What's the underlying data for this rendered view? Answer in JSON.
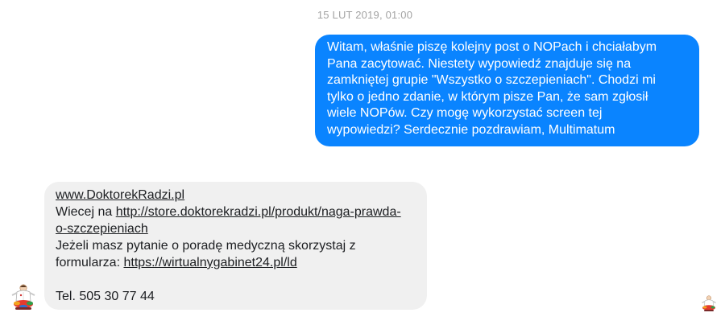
{
  "timestamp": "15 LUT 2019, 01:00",
  "outgoing_message": {
    "lines": [
      "Witam, właśnie piszę kolejny post o NOPach i chciałabym",
      "Pana zacytować. Niestety wypowiedź znajduje się na",
      "zamkniętej grupie \"Wszystko o szczepieniach\". Chodzi mi",
      "tylko o jedno zdanie, w którym pisze Pan, że sam zgłosił",
      "wiele NOPów. Czy mogę wykorzystać screen tej",
      "wypowiedzi? Serdecznie pozdrawiam, Multimatum"
    ]
  },
  "incoming_message": {
    "site_link": "www.DoktorekRadzi.pl",
    "more_prefix": "Wiecej na ",
    "store_link_line1": "http://store.doktorekradzi.pl/produkt/naga-prawda-",
    "store_link_line2": "o-szczepieniach",
    "question_line": "Jeżeli masz pytanie o poradę medyczną skorzystaj z",
    "form_prefix": "formularza: ",
    "form_link": "https://wirtualnygabinet24.pl/ld",
    "phone": "Tel. 505 30 77 44"
  },
  "colors": {
    "outgoing_bubble": "#0a84ff",
    "incoming_bubble": "#f0f0f0",
    "timestamp": "#a3a3a3"
  },
  "icons": {
    "sender_avatar": "doctor-logo-avatar",
    "read_receipt": "doctor-logo-read-receipt"
  }
}
